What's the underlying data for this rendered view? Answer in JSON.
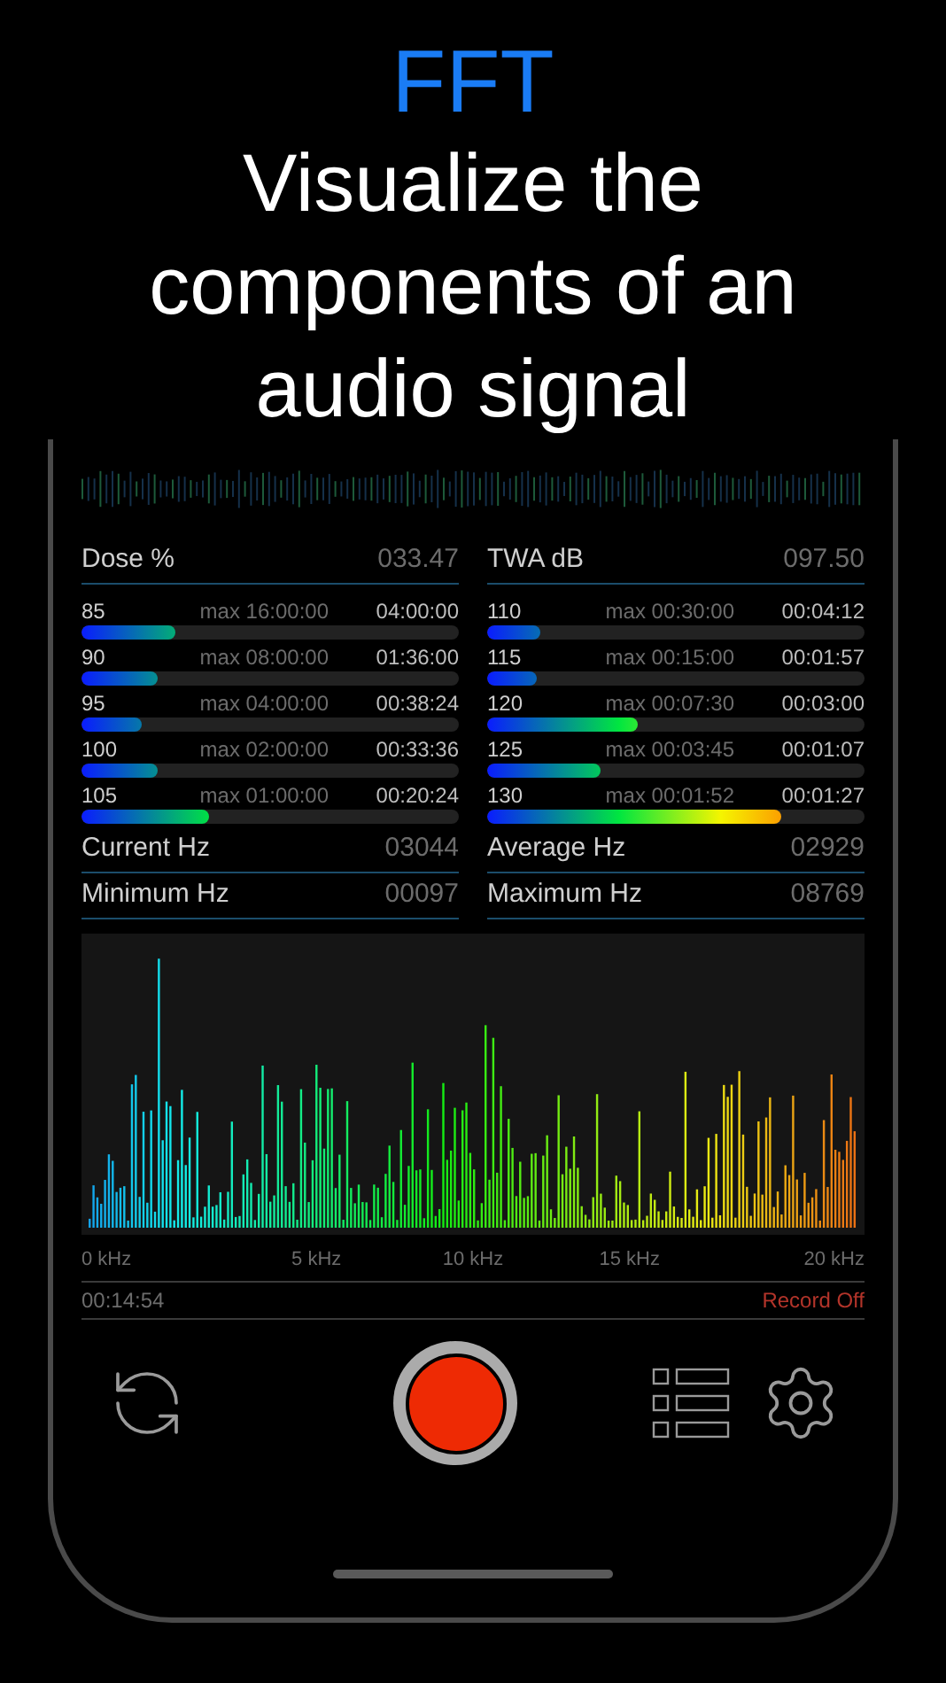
{
  "header": {
    "title": "FFT",
    "headline": "Visualize the components of an audio signal"
  },
  "dose": {
    "label": "Dose %",
    "value": "033.47",
    "rows": [
      {
        "db": "85",
        "max": "max 16:00:00",
        "time": "04:00:00",
        "level": 0.25
      },
      {
        "db": "90",
        "max": "max 08:00:00",
        "time": "01:36:00",
        "level": 0.2
      },
      {
        "db": "95",
        "max": "max 04:00:00",
        "time": "00:38:24",
        "level": 0.16
      },
      {
        "db": "100",
        "max": "max 02:00:00",
        "time": "00:33:36",
        "level": 0.2
      },
      {
        "db": "105",
        "max": "max 01:00:00",
        "time": "00:20:24",
        "level": 0.34
      }
    ]
  },
  "twa": {
    "label": "TWA dB",
    "value": "097.50",
    "rows": [
      {
        "db": "110",
        "max": "max 00:30:00",
        "time": "00:04:12",
        "level": 0.14
      },
      {
        "db": "115",
        "max": "max 00:15:00",
        "time": "00:01:57",
        "level": 0.13
      },
      {
        "db": "120",
        "max": "max 00:07:30",
        "time": "00:03:00",
        "level": 0.4
      },
      {
        "db": "125",
        "max": "max 00:03:45",
        "time": "00:01:07",
        "level": 0.3
      },
      {
        "db": "130",
        "max": "max 00:01:52",
        "time": "00:01:27",
        "level": 0.78
      }
    ]
  },
  "stats": [
    {
      "label": "Current Hz",
      "value": "03044"
    },
    {
      "label": "Average Hz",
      "value": "02929"
    },
    {
      "label": "Minimum Hz",
      "value": "00097"
    },
    {
      "label": "Maximum Hz",
      "value": "08769"
    }
  ],
  "spectrum": {
    "axis_labels": [
      "0 kHz",
      "5 kHz",
      "10 kHz",
      "15 kHz",
      "20 kHz"
    ]
  },
  "elapsed": "00:14:54",
  "record_status": "Record Off"
}
